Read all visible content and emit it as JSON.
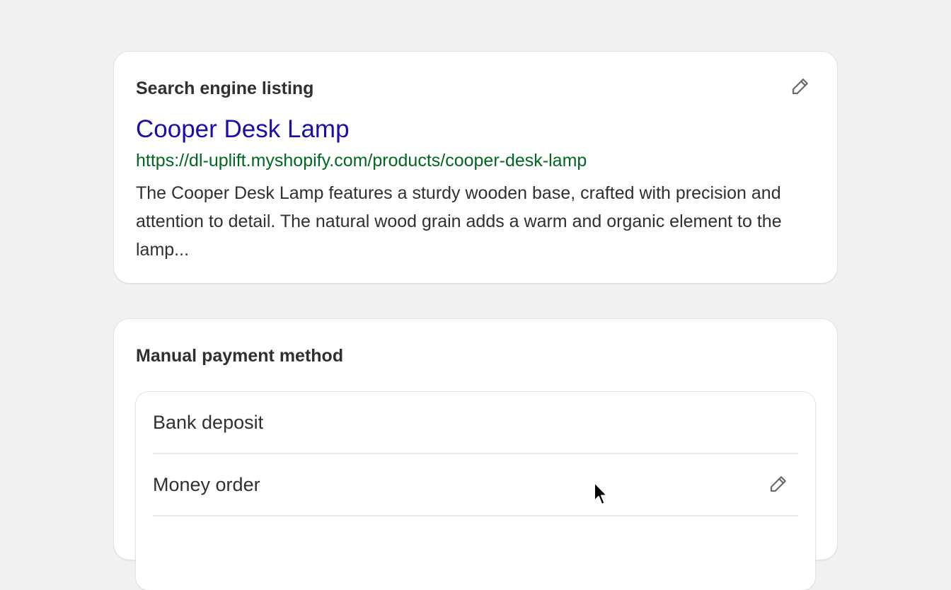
{
  "seo_card": {
    "heading": "Search engine listing",
    "edit_icon": "pencil-icon",
    "title": "Cooper Desk Lamp",
    "url": "https://dl-uplift.myshopify.com/products/cooper-desk-lamp",
    "description": "The Cooper Desk Lamp features a sturdy wooden base, crafted with precision and attention to detail. The natural wood grain adds a warm and organic element to the lamp...",
    "colors": {
      "title": "#1a0dab",
      "url": "#006621",
      "text": "#303030"
    }
  },
  "payment_card": {
    "heading": "Manual payment method",
    "methods": [
      {
        "label": "Bank deposit",
        "editable": false
      },
      {
        "label": "Money order",
        "editable": true,
        "edit_icon": "pencil-icon"
      }
    ]
  },
  "page": {
    "background": "#f1f1f1",
    "card_background": "#ffffff",
    "cursor_icon": "mouse-pointer-icon"
  }
}
